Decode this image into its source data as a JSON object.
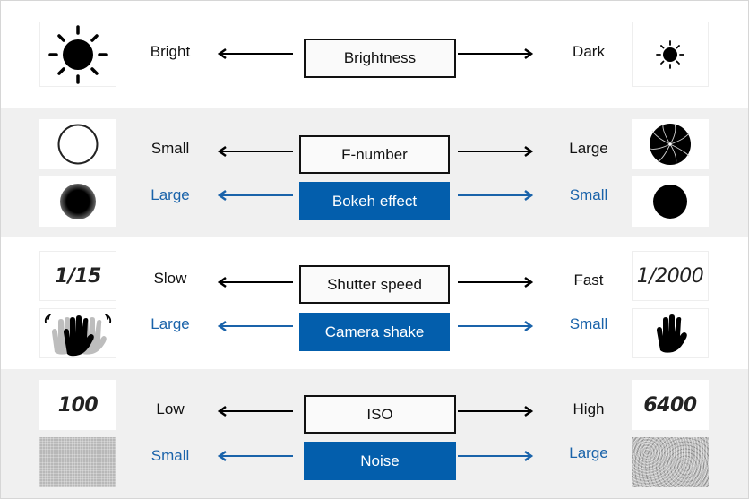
{
  "rows": [
    {
      "id": "brightness",
      "band": "white",
      "parameter": {
        "label": "Brightness",
        "left": {
          "label": "Bright",
          "icon": "sun-large-icon"
        },
        "right": {
          "label": "Dark",
          "icon": "sun-small-icon"
        }
      }
    },
    {
      "id": "aperture",
      "band": "grey",
      "parameter": {
        "label": "F-number",
        "left": {
          "label": "Small",
          "icon": "aperture-open-icon"
        },
        "right": {
          "label": "Large",
          "icon": "aperture-closed-icon"
        }
      },
      "effect": {
        "label": "Bokeh effect",
        "left": {
          "label": "Large",
          "icon": "blurred-circle-icon"
        },
        "right": {
          "label": "Small",
          "icon": "sharp-circle-icon"
        }
      }
    },
    {
      "id": "shutter",
      "band": "white",
      "parameter": {
        "label": "Shutter speed",
        "left": {
          "label": "Slow",
          "value": "1/15"
        },
        "right": {
          "label": "Fast",
          "value": "1/2000"
        }
      },
      "effect": {
        "label": "Camera shake",
        "left": {
          "label": "Large",
          "icon": "shaking-hand-icon"
        },
        "right": {
          "label": "Small",
          "icon": "steady-hand-icon"
        }
      }
    },
    {
      "id": "iso",
      "band": "grey",
      "parameter": {
        "label": "ISO",
        "left": {
          "label": "Low",
          "value": "100"
        },
        "right": {
          "label": "High",
          "value": "6400"
        }
      },
      "effect": {
        "label": "Noise",
        "left": {
          "label": "Small",
          "icon": "low-noise-texture-icon"
        },
        "right": {
          "label": "Large",
          "icon": "high-noise-texture-icon"
        }
      }
    }
  ],
  "colors": {
    "accent_blue": "#035eac",
    "blue_text": "#1a63aa",
    "grey_band": "#f0f0f0",
    "black": "#111111"
  }
}
